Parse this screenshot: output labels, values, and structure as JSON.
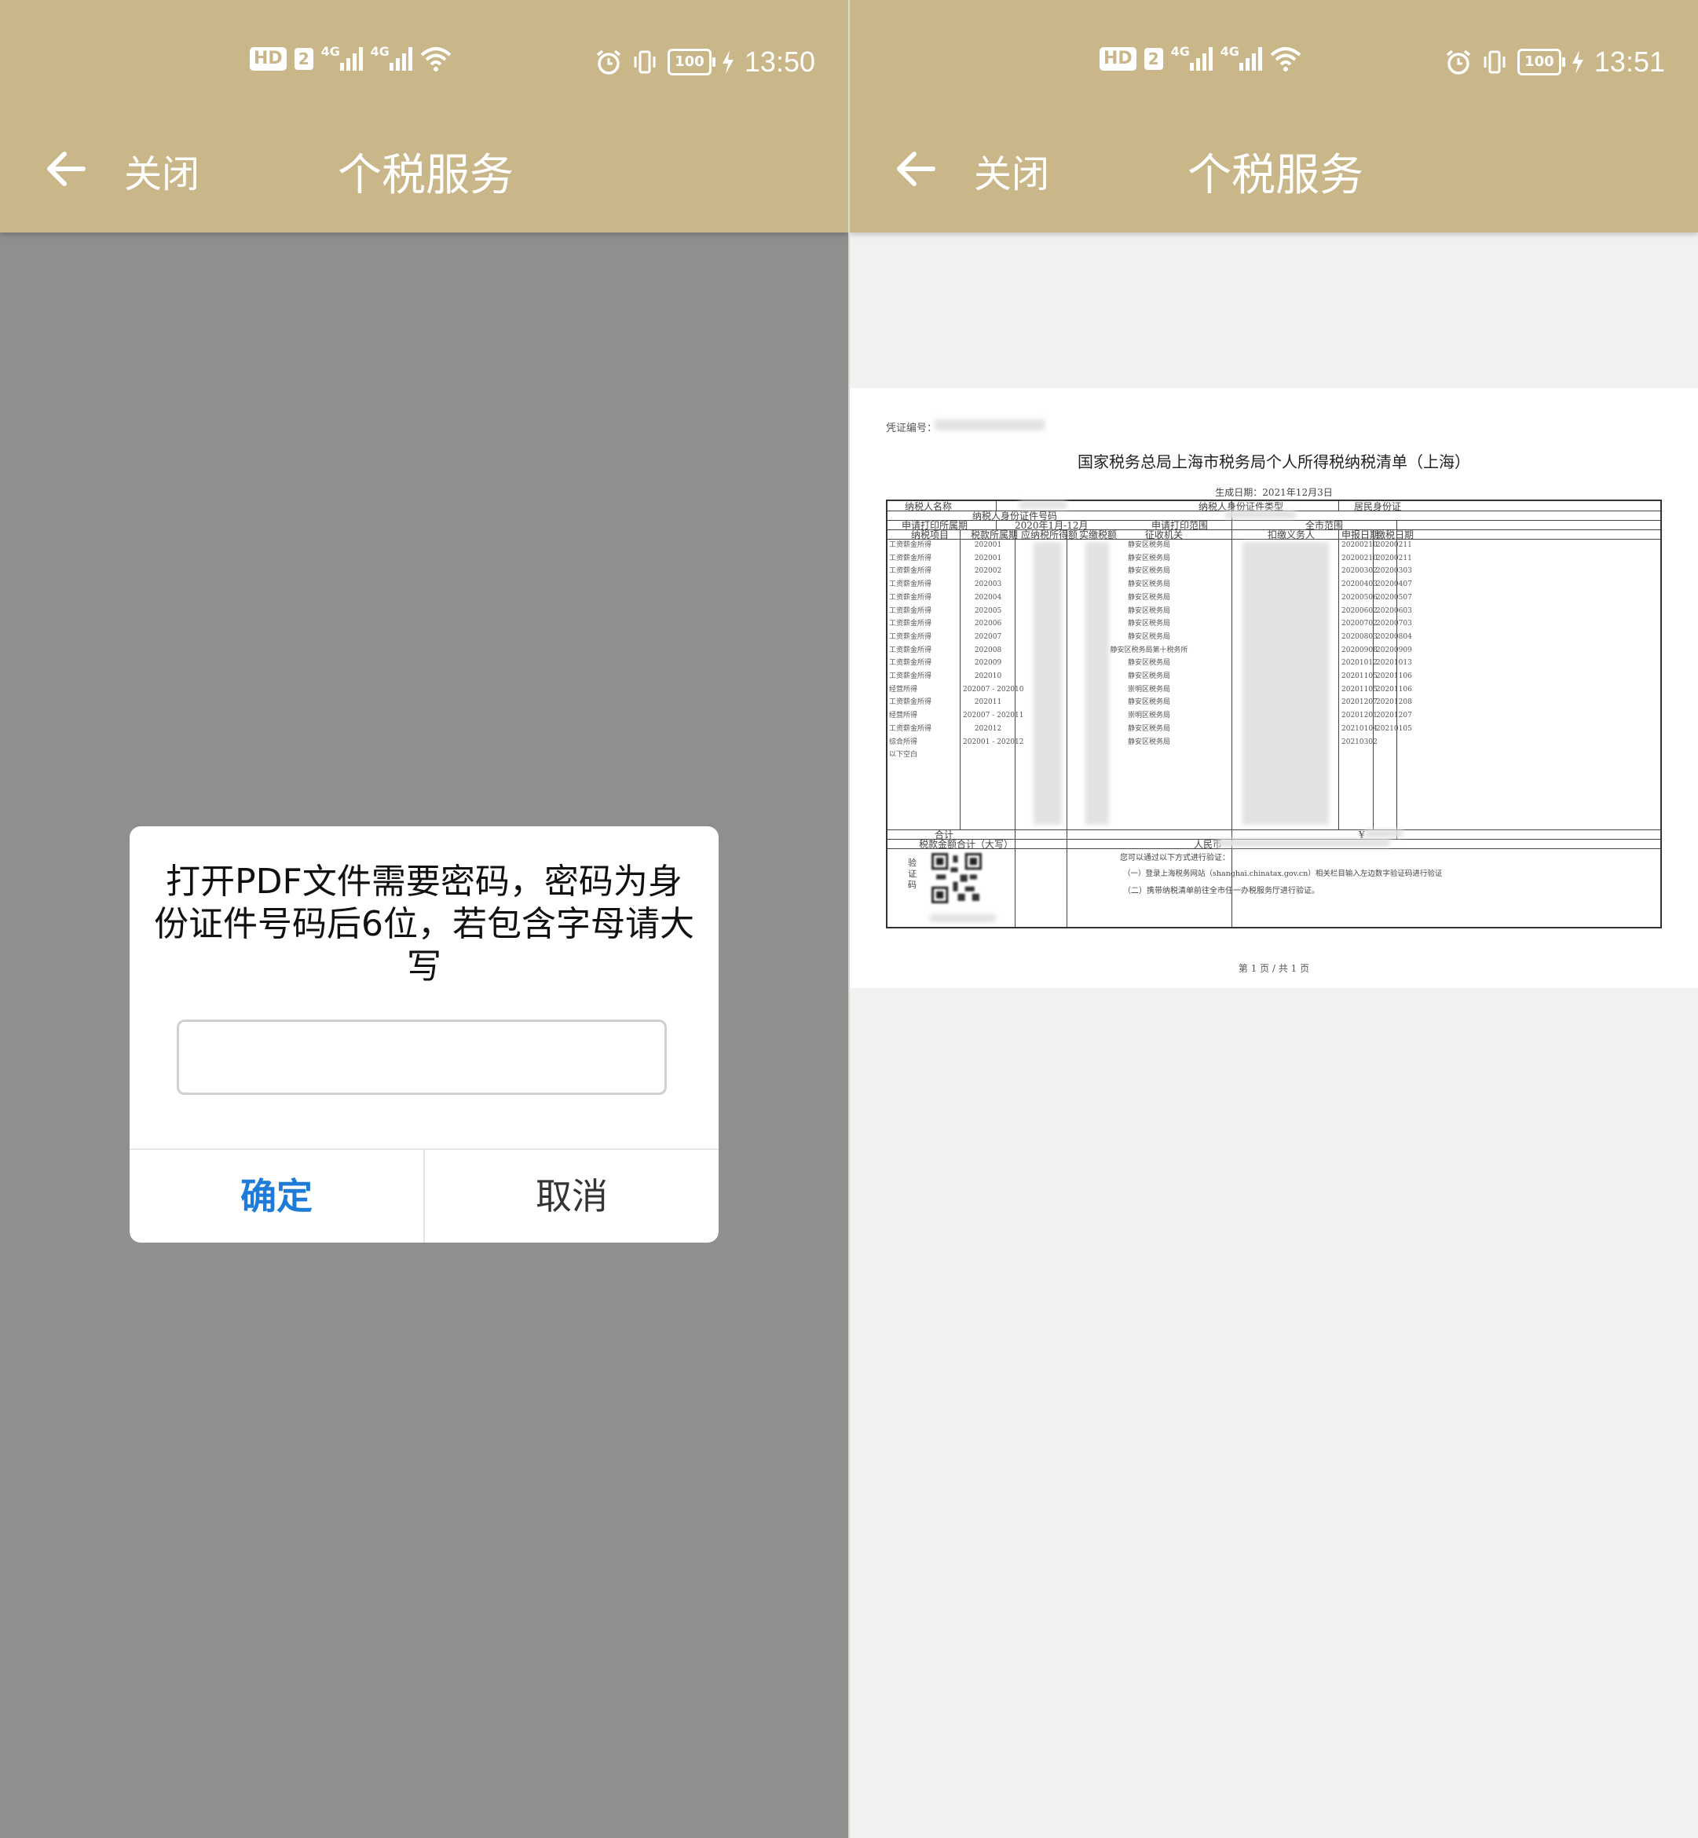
{
  "colors": {
    "header_bg": "#c9b689",
    "overlay_bg": "#8f8f8e",
    "viewer_bg": "#f1f1ef",
    "accent": "#1e7cd8"
  },
  "left": {
    "status": {
      "hd": "HD",
      "sim": "2",
      "net1": "4G",
      "net2": "4G",
      "battery": "100",
      "time": "13:50"
    },
    "nav": {
      "close": "关闭",
      "title": "个税服务"
    },
    "dialog": {
      "message": "打开PDF文件需要密码，密码为身份证件号码后6位，若包含字母请大写",
      "input_value": "",
      "ok": "确定",
      "cancel": "取消"
    }
  },
  "right": {
    "status": {
      "hd": "HD",
      "sim": "2",
      "net1": "4G",
      "net2": "4G",
      "battery": "100",
      "time": "13:51"
    },
    "nav": {
      "close": "关闭",
      "title": "个税服务"
    },
    "document": {
      "cert_label": "凭证编号：",
      "title": "国家税务总局上海市税务局个人所得税纳税清单（上海）",
      "generated": "生成日期：2021年12月3日",
      "row1": {
        "name_label": "纳税人名称",
        "id_type_label": "纳税人身份证件类型",
        "id_type": "居民身份证"
      },
      "row2": {
        "id_no_label": "纳税人身份证件号码"
      },
      "row3": {
        "period_label": "申请打印所属期",
        "period": "2020年1月-12月",
        "scope_label": "申请打印范围",
        "scope": "全市范围"
      },
      "headers": [
        "纳税项目",
        "税款所属期",
        "应纳税所得额",
        "实缴税额",
        "征收机关",
        "扣缴义务人",
        "申报日期",
        "缴税日期"
      ],
      "items": [
        "工资薪金所得",
        "工资薪金所得",
        "工资薪金所得",
        "工资薪金所得",
        "工资薪金所得",
        "工资薪金所得",
        "工资薪金所得",
        "工资薪金所得",
        "工资薪金所得",
        "工资薪金所得",
        "工资薪金所得",
        "经营所得",
        "工资薪金所得",
        "经营所得",
        "工资薪金所得",
        "综合所得",
        "以下空白"
      ],
      "periods": [
        "202001",
        "202001",
        "202002",
        "202003",
        "202004",
        "202005",
        "202006",
        "202007",
        "202008",
        "202009",
        "202010",
        "202007 - 202010",
        "202011",
        "202007 - 202011",
        "202012",
        "202001 - 202012"
      ],
      "authorities": [
        "静安区税务局",
        "静安区税务局",
        "静安区税务局",
        "静安区税务局",
        "静安区税务局",
        "静安区税务局",
        "静安区税务局",
        "静安区税务局",
        "静安区税务局第十税务所",
        "静安区税务局",
        "静安区税务局",
        "崇明区税务局",
        "静安区税务局",
        "崇明区税务局",
        "静安区税务局",
        "静安区税务局"
      ],
      "declare_dates": [
        "20200210",
        "20200210",
        "20200302",
        "20200403",
        "20200506",
        "20200602",
        "20200702",
        "20200803",
        "20200908",
        "20201012",
        "20201105",
        "20201105",
        "20201207",
        "20201201",
        "20210104",
        "20210302"
      ],
      "pay_dates": [
        "20200211",
        "20200211",
        "20200303",
        "20200407",
        "20200507",
        "20200603",
        "20200703",
        "20200804",
        "20200909",
        "20201013",
        "20201106",
        "20201106",
        "20201208",
        "20201207",
        "20210105"
      ],
      "total_label": "合计",
      "total_symbol": "¥",
      "amount_words_label": "税款金额合计（大写）",
      "currency_label": "人民币",
      "verify_label": "验证码",
      "verify_intro": "您可以通过以下方式进行验证：",
      "verify_1": "（一）登录上海税务网站（shanghai.chinatax.gov.cn）相关栏目输入左边数字验证码进行验证",
      "verify_2": "（二）携带纳税清单前往全市任一办税服务厅进行验证。",
      "page_info": "第 1 页 / 共 1 页"
    }
  }
}
